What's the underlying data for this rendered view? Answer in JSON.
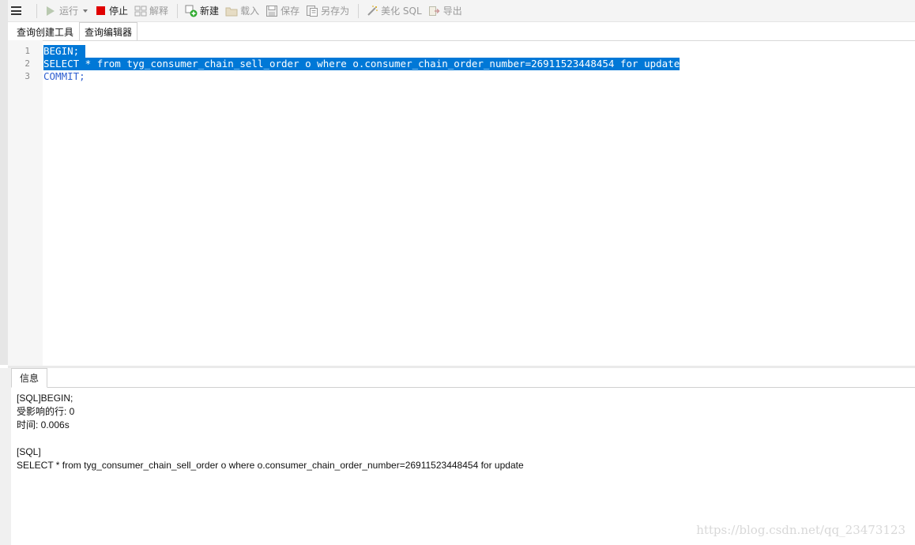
{
  "toolbar": {
    "run_label": "运行",
    "stop_label": "停止",
    "explain_label": "解释",
    "new_label": "新建",
    "load_label": "载入",
    "save_label": "保存",
    "saveas_label": "另存为",
    "beautify_label": "美化 SQL",
    "export_label": "导出"
  },
  "tabs": [
    {
      "label": "查询创建工具",
      "active": false
    },
    {
      "label": "查询编辑器",
      "active": true
    }
  ],
  "editor": {
    "line_numbers": [
      "1",
      "2",
      "3"
    ],
    "lines": [
      "BEGIN;",
      "SELECT * from tyg_consumer_chain_sell_order o where o.consumer_chain_order_number=26911523448454 for update",
      "COMMIT;"
    ]
  },
  "info": {
    "tab_label": "信息",
    "lines": [
      "[SQL]BEGIN;",
      "受影响的行: 0",
      "时间: 0.006s",
      "",
      "[SQL]",
      "SELECT * from tyg_consumer_chain_sell_order o where o.consumer_chain_order_number=26911523448454 for update"
    ]
  },
  "watermark": "https://blog.csdn.net/qq_23473123",
  "colors": {
    "selection": "#0078d7",
    "stop": "#e00000",
    "keyword": "#2f5fd0"
  }
}
